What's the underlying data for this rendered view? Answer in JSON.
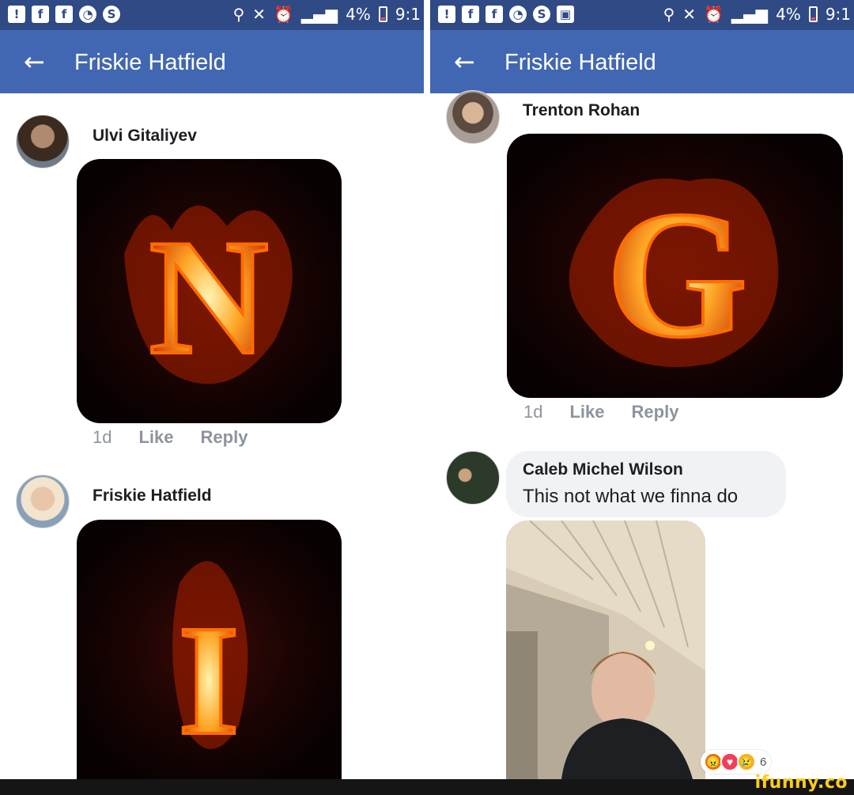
{
  "status": {
    "left_icons": [
      "!",
      "f",
      "f",
      "◔",
      "S"
    ],
    "right_text_left": "4%",
    "time": "9:1",
    "right_icons_right": [
      "!",
      "f",
      "f",
      "◔",
      "S",
      "▣"
    ]
  },
  "header": {
    "title": "Friskie Hatfield"
  },
  "left_panel": {
    "comments": [
      {
        "author": "Ulvi Gitaliyev",
        "letter": "N",
        "time": "1d",
        "like": "Like",
        "reply": "Reply"
      },
      {
        "author": "Friskie Hatfield",
        "letter": "I"
      }
    ]
  },
  "right_panel": {
    "comments": [
      {
        "author": "Trenton Rohan",
        "letter": "G",
        "time": "1d",
        "like": "Like",
        "reply": "Reply"
      },
      {
        "author": "Caleb Michel Wilson",
        "text": "This not what we finna do"
      }
    ],
    "reaction_count": "6"
  },
  "watermark": "ifunny.co",
  "colors": {
    "status_bar": "#2f4a85",
    "app_bar": "#4267b2",
    "fire": "#ff8a1a",
    "bubble": "#f1f2f6"
  }
}
